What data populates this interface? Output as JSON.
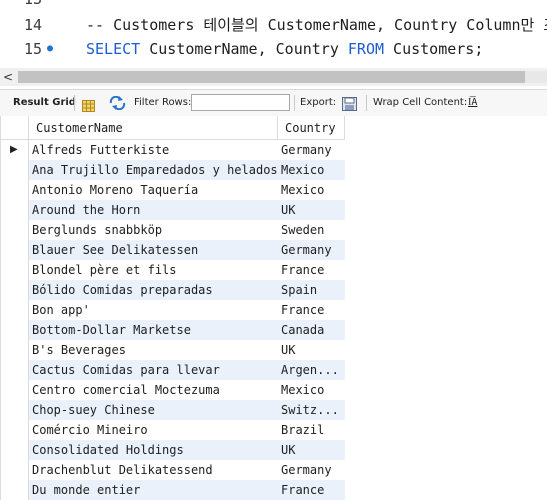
{
  "editor": {
    "lines": [
      {
        "num": "13",
        "code": ""
      },
      {
        "num": "14",
        "comment": "-- Customers 테이블의 CustomerName, Country Column만 조회"
      },
      {
        "num": "15",
        "kw1": "SELECT",
        "mid": " CustomerName, Country ",
        "kw2": "FROM",
        "tail": " Customers;"
      }
    ],
    "active_marker": "●"
  },
  "scrollbar": {
    "left_arrow": "<"
  },
  "toolbar": {
    "result_grid": "Result Grid",
    "filter_rows": "Filter Rows:",
    "filter_value": "",
    "export": "Export:",
    "wrap_cell_content": "Wrap Cell Content:",
    "wrap_icon": "I͞A"
  },
  "grid": {
    "columns": [
      "CustomerName",
      "Country"
    ],
    "current_row_marker": "▶",
    "rows": [
      [
        "Alfreds Futterkiste",
        "Germany"
      ],
      [
        "Ana Trujillo Emparedados y helados",
        "Mexico"
      ],
      [
        "Antonio Moreno Taquería",
        "Mexico"
      ],
      [
        "Around the Horn",
        "UK"
      ],
      [
        "Berglunds snabbköp",
        "Sweden"
      ],
      [
        "Blauer See Delikatessen",
        "Germany"
      ],
      [
        "Blondel père et fils",
        "France"
      ],
      [
        "Bólido Comidas preparadas",
        "Spain"
      ],
      [
        "Bon app'",
        "France"
      ],
      [
        "Bottom-Dollar Marketse",
        "Canada"
      ],
      [
        "B's Beverages",
        "UK"
      ],
      [
        "Cactus Comidas para llevar",
        "Argen..."
      ],
      [
        "Centro comercial Moctezuma",
        "Mexico"
      ],
      [
        "Chop-suey Chinese",
        "Switz..."
      ],
      [
        "Comércio Mineiro",
        "Brazil"
      ],
      [
        "Consolidated Holdings",
        "UK"
      ],
      [
        "Drachenblut Delikatessend",
        "Germany"
      ],
      [
        "Du monde entier",
        "France"
      ]
    ]
  }
}
